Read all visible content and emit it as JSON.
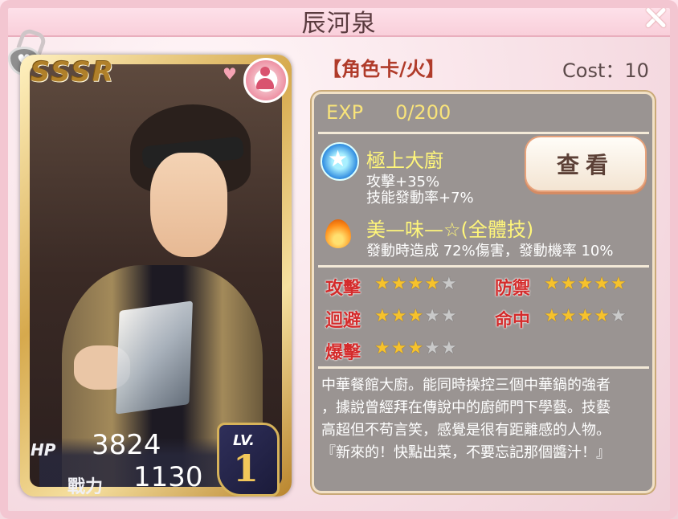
{
  "window": {
    "title": "辰河泉"
  },
  "card": {
    "rarity": "SSSR",
    "hp_label": "HP",
    "hp": "3824",
    "power_label": "戰力",
    "power": "1130",
    "lv_label": "LV.",
    "lv": "1"
  },
  "info": {
    "tag": "【角色卡/火】",
    "cost": "Cost：10",
    "exp_label": "EXP",
    "exp_value": "0/200"
  },
  "skills": [
    {
      "name": "極上大廚",
      "desc": [
        "攻擊+35%",
        "技能發動率+7%"
      ],
      "icon": "star-badge-icon"
    },
    {
      "name": "美—味—☆(全體技)",
      "desc": [
        "發動時造成 72%傷害，發動機率 10%"
      ],
      "icon": "flame-icon"
    }
  ],
  "view_button": "查看",
  "stats": [
    {
      "label": "攻擊",
      "stars": 4,
      "max": 5
    },
    {
      "label": "防禦",
      "stars": 5,
      "max": 5
    },
    {
      "label": "迴避",
      "stars": 3,
      "max": 5
    },
    {
      "label": "命中",
      "stars": 4,
      "max": 5
    },
    {
      "label": "爆擊",
      "stars": 3,
      "max": 5
    }
  ],
  "description": [
    "中華餐館大廚。能同時操控三個中華鍋的強者",
    "，據說曾經拜在傳說中的廚師門下學藝。技藝",
    "高超但不苟言笑，感覺是很有距離感的人物。",
    "『新來的！快點出菜，不要忘記那個醬汁！』"
  ],
  "colors": {
    "stat_label": "#d42b2b",
    "star_on": "#f6c22c",
    "skill_name": "#fff67a",
    "exp": "#f8e37a"
  }
}
